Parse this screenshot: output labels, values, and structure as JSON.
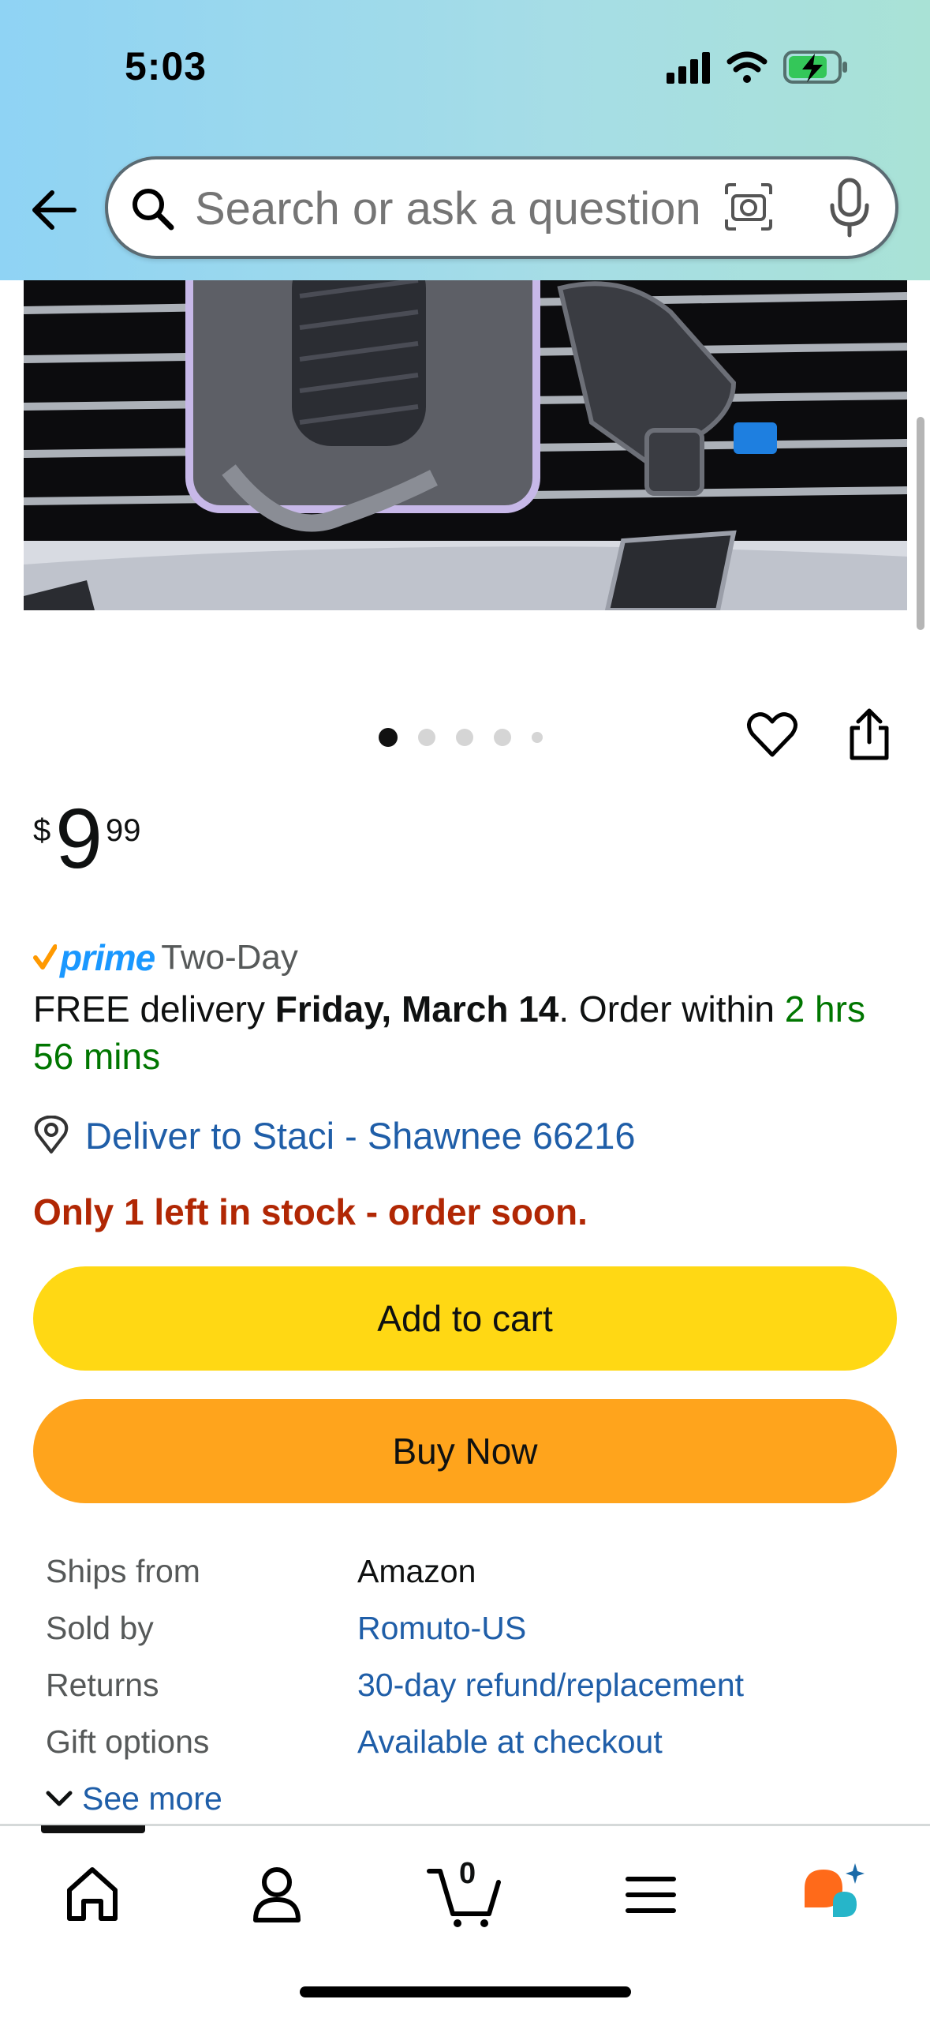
{
  "status_bar": {
    "time": "5:03",
    "icons": [
      "signal-icon",
      "wifi-icon",
      "battery-charging-icon"
    ],
    "battery_color": "#34c759"
  },
  "search": {
    "placeholder": "Search or ask a question"
  },
  "product": {
    "image_dots": 5,
    "active_dot": 0
  },
  "price": {
    "symbol": "$",
    "whole": "9",
    "fraction": "99"
  },
  "delivery": {
    "prime_label": "prime",
    "prime_type": "Two-Day",
    "prefix": "FREE delivery ",
    "date": "Friday, March 14",
    "middle": ". Order within ",
    "countdown": "2 hrs 56 mins",
    "deliver_to": "Deliver to Staci - Shawnee 66216"
  },
  "stock": {
    "message": "Only 1 left in stock - order soon."
  },
  "buttons": {
    "add_to_cart": "Add to cart",
    "buy_now": "Buy Now"
  },
  "details": [
    {
      "label": "Ships from",
      "value": "Amazon"
    },
    {
      "label": "Sold by",
      "value": "Romuto-US"
    },
    {
      "label": "Returns",
      "value": "30-day refund/replacement"
    },
    {
      "label": "Gift options",
      "value": "Available at checkout"
    }
  ],
  "see_more": "See more",
  "bottom_nav": {
    "cart_count": "0",
    "items": [
      "home-icon",
      "account-icon",
      "cart-icon",
      "menu-icon",
      "rufus-icon"
    ]
  },
  "colors": {
    "cart_button": "#ffd814",
    "buy_button": "#ffa41c",
    "link": "#1f5ea8",
    "stock": "#b12704",
    "prime": "#1a98ff"
  }
}
